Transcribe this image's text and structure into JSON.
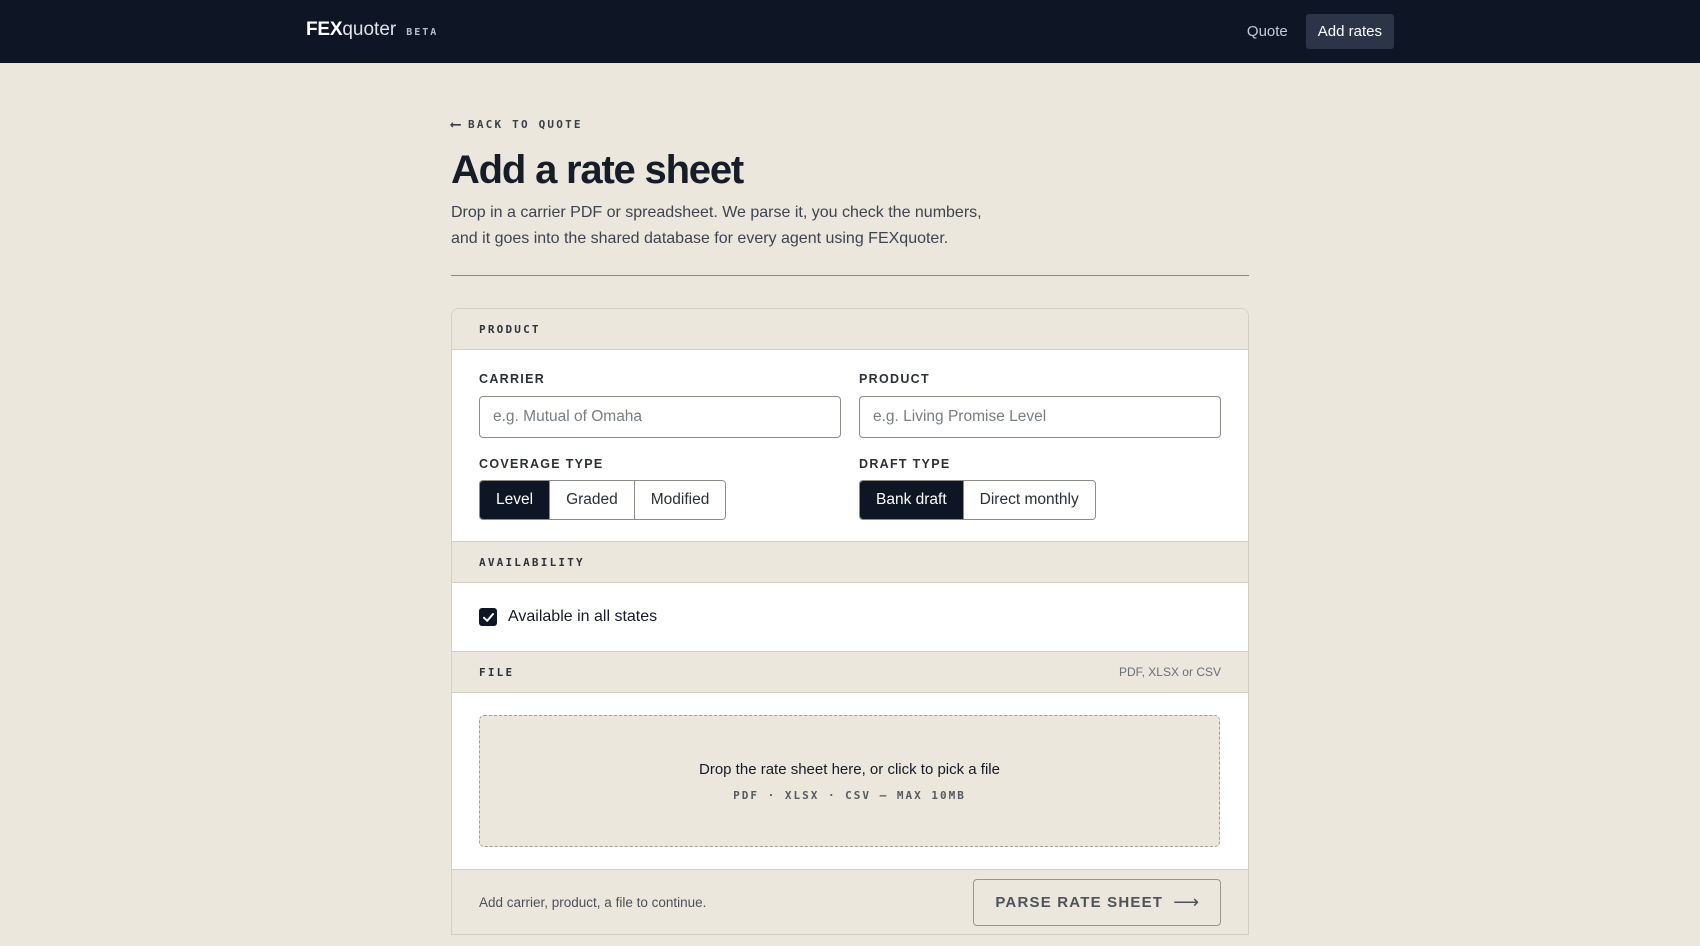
{
  "header": {
    "brand_strong": "FEX",
    "brand_light": "quoter",
    "brand_badge": "BETA",
    "nav": [
      {
        "label": "Quote",
        "active": false
      },
      {
        "label": "Add rates",
        "active": true
      }
    ]
  },
  "page": {
    "back_label": "BACK TO QUOTE",
    "title": "Add a rate sheet",
    "subtitle": "Drop in a carrier PDF or spreadsheet. We parse it, you check the numbers, and it goes into the shared database for every agent using FEXquoter."
  },
  "product_section": {
    "title": "PRODUCT",
    "carrier": {
      "label": "CARRIER",
      "value": "",
      "placeholder": "e.g. Mutual of Omaha"
    },
    "product": {
      "label": "PRODUCT",
      "value": "",
      "placeholder": "e.g. Living Promise Level"
    },
    "coverage_type": {
      "label": "COVERAGE TYPE",
      "options": [
        "Level",
        "Graded",
        "Modified"
      ],
      "selected": "Level"
    },
    "draft_type": {
      "label": "DRAFT TYPE",
      "options": [
        "Bank draft",
        "Direct monthly"
      ],
      "selected": "Bank draft"
    }
  },
  "availability_section": {
    "title": "AVAILABILITY",
    "all_states_label": "Available in all states",
    "all_states_checked": true
  },
  "file_section": {
    "title": "FILE",
    "hint": "PDF, XLSX or CSV",
    "drop_title": "Drop the rate sheet here, or click to pick a file",
    "drop_sub": "PDF · XLSX · CSV — MAX 10MB"
  },
  "footer": {
    "message": "Add carrier, product, a file to continue.",
    "parse_label": "PARSE RATE SHEET"
  },
  "icons": {
    "back": "arrow-left-icon",
    "parse": "arrow-right-icon",
    "check": "checkmark-icon"
  },
  "colors": {
    "nav_bg": "#0e1525",
    "page_bg": "#ebe7dd",
    "selected_bg": "#0e1525"
  }
}
